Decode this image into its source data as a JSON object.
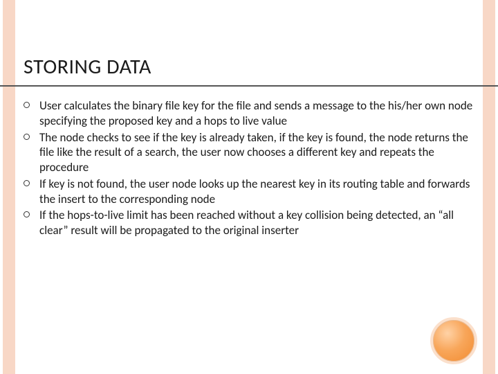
{
  "slide": {
    "title": "STORING DATA",
    "bullets": [
      {
        "text": "User calculates the binary file key for the file and sends a message to the his/her own node specifying the proposed key and a hops to live value"
      },
      {
        "text": "The node checks to see if the key is already taken, if the key is found, the node returns the file like the result of a search, the user now chooses a different key and repeats the procedure"
      },
      {
        "text": "If key is not found, the user node looks up the nearest key in its routing table and forwards the insert to the corresponding node"
      },
      {
        "text": "If the hops-to-live limit has been reached without a key collision being detected, an “all clear” result will be propagated to the original inserter"
      }
    ]
  },
  "theme": {
    "accent": "#f28a2e",
    "strip": "#f8d7c6"
  }
}
